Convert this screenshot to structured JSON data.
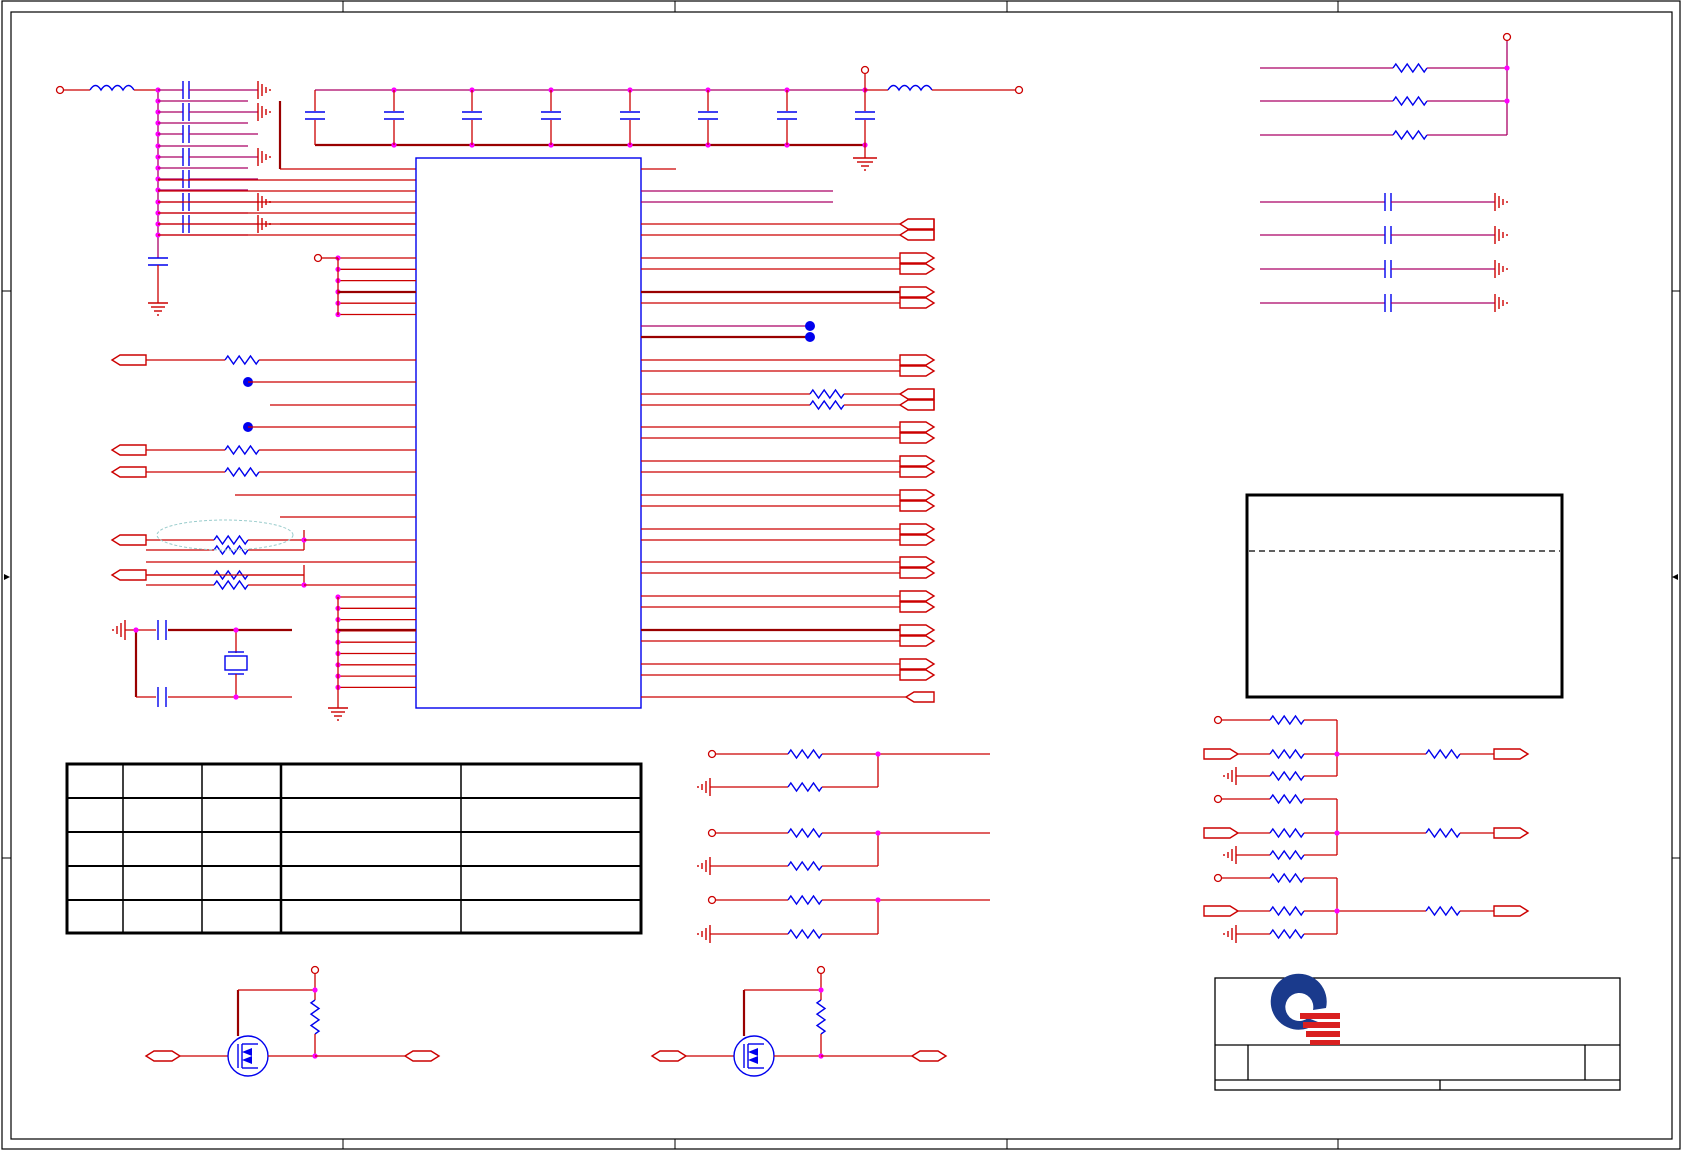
{
  "sheet": {
    "border_color": "#000000",
    "wire_color": "#cc0000",
    "bus_color": "#990000",
    "component_color": "#0000ee",
    "junction_color": "#ff00ff"
  },
  "title_block": {
    "logo_colors": {
      "ring": "#1a3a8c",
      "bars": "#d92020"
    }
  }
}
